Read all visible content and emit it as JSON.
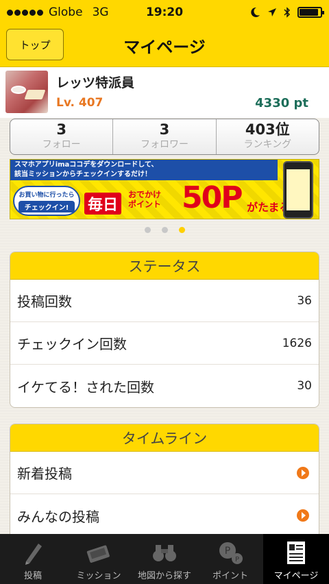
{
  "status_bar": {
    "carrier": "Globe",
    "network": "3G",
    "time": "19:20",
    "battery_level": 0.9
  },
  "header": {
    "title": "マイページ",
    "top_button_label": "トップ"
  },
  "profile": {
    "username": "レッツ特派員",
    "level": "Lv. 407",
    "points": "4330 pt"
  },
  "stats": [
    {
      "value": "3",
      "label": "フォロー"
    },
    {
      "value": "3",
      "label": "フォロワー"
    },
    {
      "value": "403位",
      "label": "ランキング"
    }
  ],
  "banner": {
    "top_line1": "スマホアプリimaココデをダウンロードして、",
    "top_line2": "該当ミッションからチェックインするだけ！",
    "bubble_line": "お買い物に行ったら",
    "bubble_checkin": "チェックイン!",
    "mainichi": "毎日",
    "odekake_line1": "おでかけ",
    "odekake_line2": "ポイント",
    "big_points": "50P",
    "tamaru": "がたまる!"
  },
  "pager": {
    "count": 3,
    "active_index": 2
  },
  "status_section": {
    "title": "ステータス",
    "rows": [
      {
        "label": "投稿回数",
        "value": "36"
      },
      {
        "label": "チェックイン回数",
        "value": "1626"
      },
      {
        "label": "イケてる！された回数",
        "value": "30"
      }
    ]
  },
  "timeline_section": {
    "title": "タイムライン",
    "rows": [
      {
        "label": "新着投稿"
      },
      {
        "label": "みんなの投稿"
      }
    ]
  },
  "tabs": [
    {
      "label": "投稿",
      "icon": "pencil-icon",
      "active": false
    },
    {
      "label": "ミッション",
      "icon": "ticket-icon",
      "active": false
    },
    {
      "label": "地図から探す",
      "icon": "binoculars-icon",
      "active": false
    },
    {
      "label": "ポイント",
      "icon": "coins-icon",
      "active": false
    },
    {
      "label": "マイページ",
      "icon": "profile-card-icon",
      "active": true
    }
  ],
  "colors": {
    "accent": "#ffd800",
    "level": "#e87722",
    "points": "#1d6e5a",
    "arrow": "#f07818"
  }
}
